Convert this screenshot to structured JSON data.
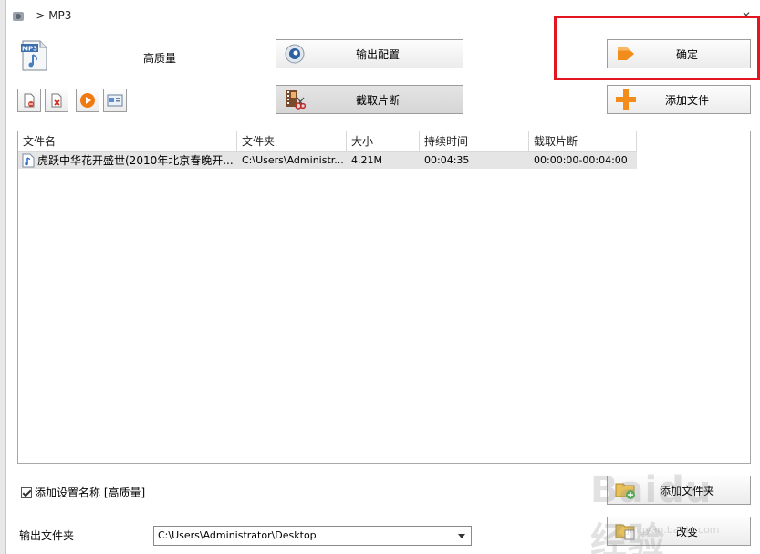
{
  "window": {
    "title": "-> MP3"
  },
  "profile": {
    "label": "高质量",
    "icon": "mp3-file-icon",
    "icon_text": "MP3"
  },
  "buttons": {
    "output_config": "输出配置",
    "confirm": "确定",
    "trim": "截取片断",
    "add_file": "添加文件",
    "add_folder": "添加文件夹",
    "change": "改变"
  },
  "toolbar_icons": [
    "remove-file-icon",
    "delete-icon",
    "play-icon",
    "media-info-icon"
  ],
  "file_list": {
    "columns": [
      "文件名",
      "文件夹",
      "大小",
      "持续时间",
      "截取片断"
    ],
    "rows": [
      {
        "name": "虎跃中华花开盛世(2010年北京春晚开...",
        "folder": "C:\\Users\\Administr...",
        "size": "4.21M",
        "duration": "00:04:35",
        "clip": "00:00:00-00:04:00"
      }
    ]
  },
  "options": {
    "add_setting_name": "添加设置名称 [高质量]",
    "add_setting_checked": true
  },
  "output": {
    "label": "输出文件夹",
    "path": "C:\\Users\\Administrator\\Desktop"
  },
  "watermark": {
    "text": "Baidu 经验",
    "sub": "jingyan.baidu.com"
  },
  "colors": {
    "highlight": "#e3161f",
    "accent_orange": "#f28c1a",
    "selected_row": "#e5e5e5"
  }
}
